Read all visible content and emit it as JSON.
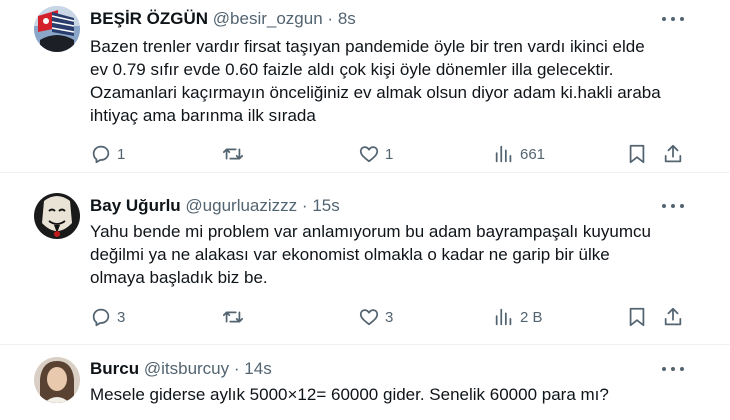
{
  "tweets": [
    {
      "name": "BEŞİR ÖZGÜN",
      "handle": "@besir_ozgun",
      "dot": "·",
      "time": "8s",
      "body_lines": [
        "Bazen trenler vardır firsat taşıyan pandemide öyle bir tren vardı ikinci elde",
        "ev 0.79 sıfır evde 0.60 faizle aldı çok kişi öyle dönemler illa gelecektir.",
        "Ozamanlari kaçırmayın önceliğiniz ev almak olsun diyor adam ki.hakli araba",
        "ihtiyaç ama barınma ilk sırada"
      ],
      "replies": "1",
      "retweets": "",
      "likes": "1",
      "views": "661"
    },
    {
      "name": "Bay Uğurlu",
      "handle": "@ugurluazizzz",
      "dot": "·",
      "time": "15s",
      "body_lines": [
        "Yahu bende mi problem var anlamıyorum bu adam bayrampaşalı kuyumcu",
        "değilmi ya ne alakası var ekonomist olmakla o kadar ne garip bir ülke",
        "olmaya başladık biz be."
      ],
      "replies": "3",
      "retweets": "",
      "likes": "3",
      "views": "2 B"
    },
    {
      "name": "Burcu",
      "handle": "@itsburcuy",
      "dot": "·",
      "time": "14s",
      "body_lines": [
        "Mesele giderse aylık 5000×12= 60000 gider. Senelik 60000 para mı?"
      ]
    }
  ],
  "icons": {
    "reply": "reply-icon",
    "retweet": "retweet-icon",
    "like": "heart-icon",
    "views": "views-icon",
    "bookmark": "bookmark-icon",
    "share": "share-icon",
    "more": "more-icon"
  },
  "colors": {
    "text": "#0f1419",
    "secondary": "#536471",
    "divider": "#eff3f4"
  }
}
